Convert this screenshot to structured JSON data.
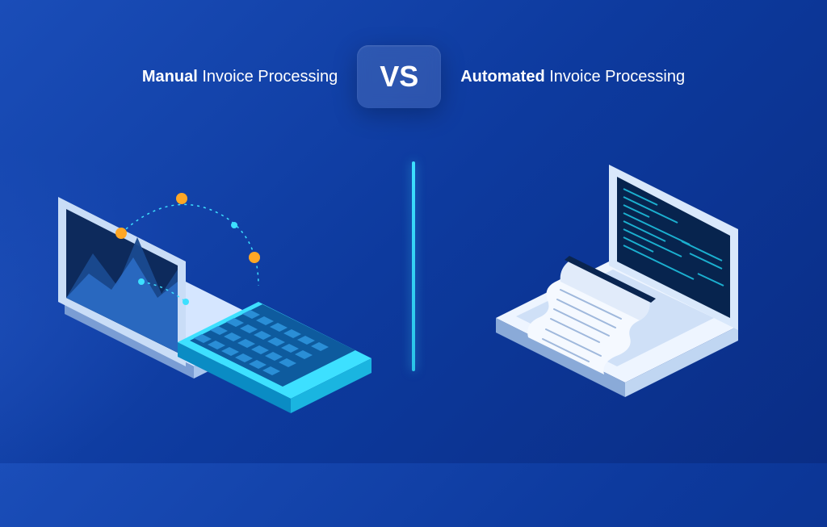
{
  "left": {
    "bold": "Manual",
    "rest": " Invoice Processing"
  },
  "center": {
    "vs": "VS"
  },
  "right": {
    "bold": "Automated",
    "rest": " Invoice Processing"
  },
  "colors": {
    "accent_cyan": "#3de0ff",
    "accent_orange": "#ffa726",
    "laptop_light": "#e8f1ff",
    "laptop_mid": "#9bb8e8",
    "laptop_dark": "#2a4d8f",
    "screen_dark": "#0a2550"
  }
}
